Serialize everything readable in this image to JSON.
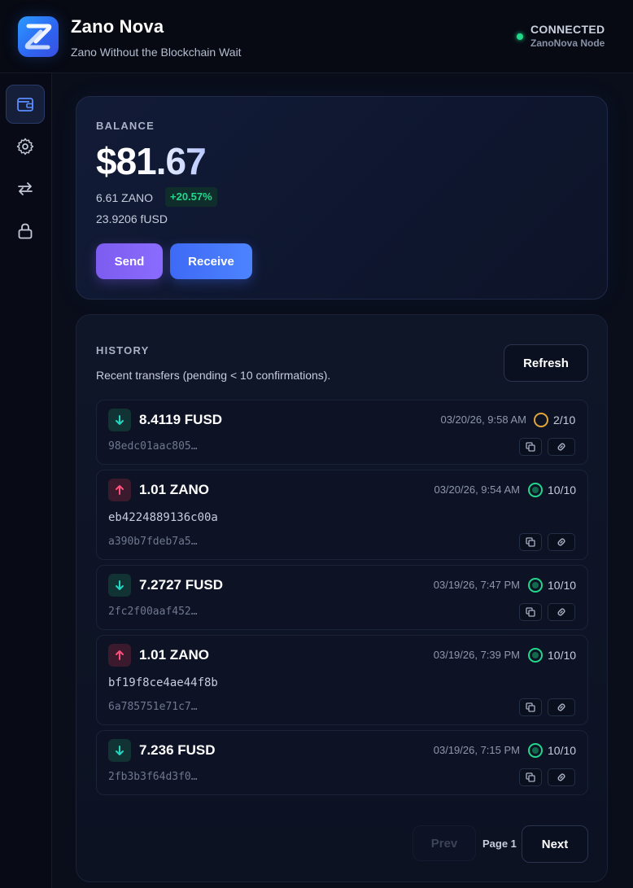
{
  "app": {
    "title": "Zano Nova",
    "subtitle": "Zano Without the Blockchain Wait"
  },
  "connection": {
    "status": "CONNECTED",
    "node": "ZanoNova Node",
    "color": "#20d98a"
  },
  "sidebar": {
    "items": [
      {
        "name": "wallet",
        "icon": "wallet-icon",
        "active": true
      },
      {
        "name": "settings",
        "icon": "gear-icon",
        "active": false
      },
      {
        "name": "swap",
        "icon": "swap-icon",
        "active": false
      },
      {
        "name": "lock",
        "icon": "lock-icon",
        "active": false
      }
    ]
  },
  "balance": {
    "label": "BALANCE",
    "amount": "$81.67",
    "zano": "6.61 ZANO",
    "change": "+20.57%",
    "fusd": "23.9206 fUSD",
    "send_label": "Send",
    "receive_label": "Receive"
  },
  "history": {
    "label": "HISTORY",
    "description": "Recent transfers (pending < 10 confirmations).",
    "refresh_label": "Refresh",
    "transactions": [
      {
        "direction": "in",
        "amount": "8.4119 FUSD",
        "date": "03/20/26, 9:58 AM",
        "status": "pending",
        "confirmations": "2/10",
        "memo": "",
        "hash": "98edc01aac805…"
      },
      {
        "direction": "out",
        "amount": "1.01 ZANO",
        "date": "03/20/26, 9:54 AM",
        "status": "done",
        "confirmations": "10/10",
        "memo": "eb4224889136c00a",
        "hash": "a390b7fdeb7a5…"
      },
      {
        "direction": "in",
        "amount": "7.2727 FUSD",
        "date": "03/19/26, 7:47 PM",
        "status": "done",
        "confirmations": "10/10",
        "memo": "",
        "hash": "2fc2f00aaf452…"
      },
      {
        "direction": "out",
        "amount": "1.01 ZANO",
        "date": "03/19/26, 7:39 PM",
        "status": "done",
        "confirmations": "10/10",
        "memo": "bf19f8ce4ae44f8b",
        "hash": "6a785751e71c7…"
      },
      {
        "direction": "in",
        "amount": "7.236 FUSD",
        "date": "03/19/26, 7:15 PM",
        "status": "done",
        "confirmations": "10/10",
        "memo": "",
        "hash": "2fb3b3f64d3f0…"
      }
    ],
    "pagination": {
      "prev_label": "Prev",
      "page_label": "Page 1",
      "next_label": "Next"
    }
  },
  "colors": {
    "incoming": "#22d6c4",
    "outgoing": "#ff4f7a",
    "pending": "#e0a63a",
    "confirmed": "#22d68c"
  }
}
